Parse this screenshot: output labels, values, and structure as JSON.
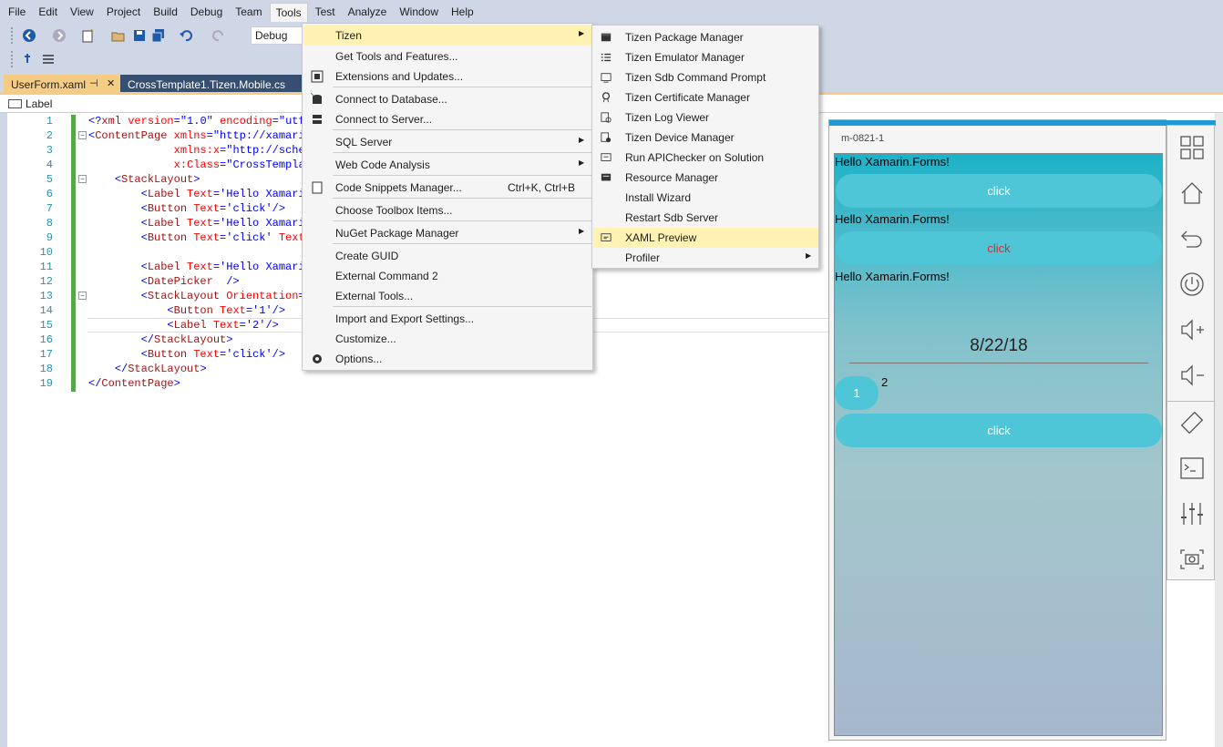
{
  "menubar": {
    "items": [
      "File",
      "Edit",
      "View",
      "Project",
      "Build",
      "Debug",
      "Team",
      "Tools",
      "Test",
      "Analyze",
      "Window",
      "Help"
    ],
    "active_index": 7
  },
  "toolbar": {
    "config_value": "Debug"
  },
  "tabs": {
    "active_label": "UserForm.xaml",
    "pin_glyph": "⊣",
    "close_glyph": "✕",
    "inactive_label": "CrossTemplate1.Tizen.Mobile.cs"
  },
  "navbar": {
    "text": "Label"
  },
  "editor": {
    "line_numbers": [
      "1",
      "2",
      "3",
      "4",
      "5",
      "6",
      "7",
      "8",
      "9",
      "10",
      "11",
      "12",
      "13",
      "14",
      "15",
      "16",
      "17",
      "18",
      "19"
    ],
    "lines": [
      {
        "indent": "",
        "parts": [
          [
            "t-blue",
            "<?"
          ],
          [
            "t-tag",
            "xml "
          ],
          [
            "t-attr",
            "version"
          ],
          [
            "t-blue",
            "=\"1.0\" "
          ],
          [
            "t-attr",
            "encoding"
          ],
          [
            "t-blue",
            "=\"utf"
          ]
        ]
      },
      {
        "indent": "",
        "parts": [
          [
            "t-blue",
            "<"
          ],
          [
            "t-tag",
            "ContentPage "
          ],
          [
            "t-attr",
            "xmlns"
          ],
          [
            "t-blue",
            "=\"http://xamarin"
          ]
        ]
      },
      {
        "indent": "             ",
        "parts": [
          [
            "t-attr",
            "xmlns:x"
          ],
          [
            "t-blue",
            "=\"http://schem"
          ]
        ]
      },
      {
        "indent": "             ",
        "parts": [
          [
            "t-attr",
            "x:Class"
          ],
          [
            "t-blue",
            "=\"CrossTemplat"
          ]
        ]
      },
      {
        "indent": "    ",
        "parts": [
          [
            "t-blue",
            "<"
          ],
          [
            "t-tag",
            "StackLayout"
          ],
          [
            "t-blue",
            ">"
          ]
        ]
      },
      {
        "indent": "        ",
        "parts": [
          [
            "t-blue",
            "<"
          ],
          [
            "t-tag",
            "Label "
          ],
          [
            "t-attr",
            "Text"
          ],
          [
            "t-blue",
            "='Hello Xamarin"
          ]
        ]
      },
      {
        "indent": "        ",
        "parts": [
          [
            "t-blue",
            "<"
          ],
          [
            "t-tag",
            "Button "
          ],
          [
            "t-attr",
            "Text"
          ],
          [
            "t-blue",
            "='click'/>"
          ]
        ]
      },
      {
        "indent": "        ",
        "parts": [
          [
            "t-blue",
            "<"
          ],
          [
            "t-tag",
            "Label "
          ],
          [
            "t-attr",
            "Text"
          ],
          [
            "t-blue",
            "='Hello Xamarin"
          ]
        ]
      },
      {
        "indent": "        ",
        "parts": [
          [
            "t-blue",
            "<"
          ],
          [
            "t-tag",
            "Button "
          ],
          [
            "t-attr",
            "Text"
          ],
          [
            "t-blue",
            "='click' "
          ],
          [
            "t-attr",
            "TextC"
          ]
        ]
      },
      {
        "indent": "",
        "parts": []
      },
      {
        "indent": "        ",
        "parts": [
          [
            "t-blue",
            "<"
          ],
          [
            "t-tag",
            "Label "
          ],
          [
            "t-attr",
            "Text"
          ],
          [
            "t-blue",
            "='Hello Xamarin"
          ]
        ]
      },
      {
        "indent": "        ",
        "parts": [
          [
            "t-blue",
            "<"
          ],
          [
            "t-tag",
            "DatePicker  "
          ],
          [
            "t-blue",
            "/>"
          ]
        ]
      },
      {
        "indent": "        ",
        "parts": [
          [
            "t-blue",
            "<"
          ],
          [
            "t-tag",
            "StackLayout "
          ],
          [
            "t-attr",
            "Orientation"
          ],
          [
            "t-blue",
            "="
          ]
        ]
      },
      {
        "indent": "            ",
        "parts": [
          [
            "t-blue",
            "<"
          ],
          [
            "t-tag",
            "Button "
          ],
          [
            "t-attr",
            "Text"
          ],
          [
            "t-blue",
            "='1'/>"
          ]
        ]
      },
      {
        "indent": "            ",
        "parts": [
          [
            "t-blue",
            "<"
          ],
          [
            "t-tag",
            "Label "
          ],
          [
            "t-attr",
            "Text"
          ],
          [
            "t-blue",
            "='2'/>"
          ]
        ]
      },
      {
        "indent": "        ",
        "parts": [
          [
            "t-blue",
            "</"
          ],
          [
            "t-tag",
            "StackLayout"
          ],
          [
            "t-blue",
            ">"
          ]
        ]
      },
      {
        "indent": "        ",
        "parts": [
          [
            "t-blue",
            "<"
          ],
          [
            "t-tag",
            "Button "
          ],
          [
            "t-attr",
            "Text"
          ],
          [
            "t-blue",
            "='click'/>"
          ]
        ]
      },
      {
        "indent": "    ",
        "parts": [
          [
            "t-blue",
            "</"
          ],
          [
            "t-tag",
            "StackLayout"
          ],
          [
            "t-blue",
            ">"
          ]
        ]
      },
      {
        "indent": "",
        "parts": [
          [
            "t-blue",
            "</"
          ],
          [
            "t-tag",
            "ContentPage"
          ],
          [
            "t-blue",
            ">"
          ]
        ]
      }
    ]
  },
  "tools_menu": {
    "items": [
      {
        "label": "Tizen",
        "arrow": true,
        "highlight": true
      },
      {
        "label": "Get Tools and Features..."
      },
      {
        "label": "Extensions and Updates...",
        "icon": "extensions-icon"
      },
      {
        "label": "Connect to Database...",
        "icon": "database-icon"
      },
      {
        "label": "Connect to Server...",
        "icon": "server-icon"
      },
      {
        "label": "SQL Server",
        "arrow": true
      },
      {
        "label": "Web Code Analysis",
        "arrow": true
      },
      {
        "label": "Code Snippets Manager...",
        "shortcut": "Ctrl+K, Ctrl+B",
        "icon": "snippet-icon"
      },
      {
        "label": "Choose Toolbox Items..."
      },
      {
        "label": "NuGet Package Manager",
        "arrow": true
      },
      {
        "label": "Create GUID"
      },
      {
        "label": "External Command 2"
      },
      {
        "label": "External Tools..."
      },
      {
        "label": "Import and Export Settings..."
      },
      {
        "label": "Customize..."
      },
      {
        "label": "Options...",
        "icon": "gear-icon"
      }
    ]
  },
  "tizen_menu": {
    "items": [
      {
        "label": "Tizen Package Manager",
        "icon": "package-icon"
      },
      {
        "label": "Tizen Emulator Manager",
        "icon": "list-icon"
      },
      {
        "label": "Tizen Sdb Command Prompt",
        "icon": "console-icon"
      },
      {
        "label": "Tizen Certificate Manager",
        "icon": "certificate-icon"
      },
      {
        "label": "Tizen Log Viewer",
        "icon": "log-icon"
      },
      {
        "label": "Tizen Device Manager",
        "icon": "device-icon"
      },
      {
        "label": "Run APIChecker on Solution",
        "icon": "apichecker-icon"
      },
      {
        "label": "Resource Manager",
        "icon": "resource-icon"
      },
      {
        "label": "Install Wizard"
      },
      {
        "label": "Restart Sdb Server"
      },
      {
        "label": "XAML Preview",
        "icon": "preview-icon",
        "highlight": true
      },
      {
        "label": "Profiler",
        "arrow": true
      }
    ]
  },
  "preview": {
    "device_name": "m-0821-1",
    "label1": "Hello Xamarin.Forms!",
    "button1": "click",
    "label2": "Hello Xamarin.Forms!",
    "button2": "click",
    "label3": "Hello Xamarin.Forms!",
    "date": "8/22/18",
    "small_button": "1",
    "small_label": "2",
    "button3": "click"
  },
  "emulator_sidebar": {
    "icons": [
      "apps-icon",
      "home-icon",
      "back-icon",
      "power-icon",
      "volume-up-icon",
      "volume-down-icon",
      "rotate-icon",
      "terminal-icon",
      "settings-sliders-icon",
      "screenshot-icon"
    ]
  },
  "colors": {
    "chrome": "#cfd6e5",
    "tab_active": "#f5cc84",
    "menu_highlight": "#fff2b3",
    "preview_accent": "#1e9ad6",
    "button_fill": "#4ec6d8"
  }
}
